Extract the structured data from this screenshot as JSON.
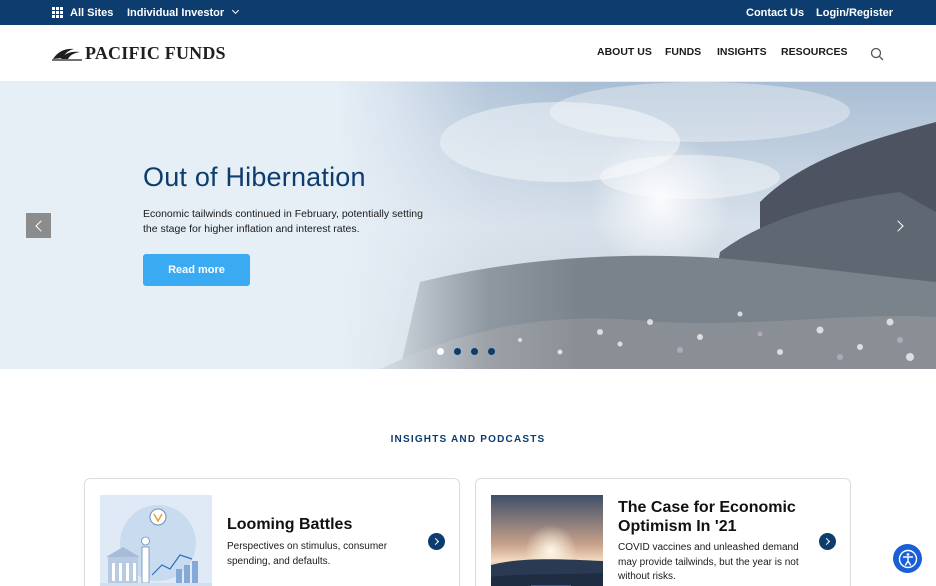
{
  "utility_bar": {
    "all_sites": "All Sites",
    "audience": "Individual Investor",
    "contact": "Contact Us",
    "login": "Login/Register"
  },
  "header": {
    "logo_text": "PACIFIC FUNDS",
    "nav": [
      "ABOUT US",
      "FUNDS",
      "INSIGHTS",
      "RESOURCES"
    ],
    "search_icon": "search-icon"
  },
  "hero": {
    "title": "Out of Hibernation",
    "text": "Economic tailwinds continued in February, potentially setting the stage for higher inflation and interest rates.",
    "button": "Read more",
    "slide_count": 4,
    "active_slide": 1
  },
  "insights": {
    "section_title": "INSIGHTS AND PODCASTS",
    "cards": [
      {
        "title": "Looming Battles",
        "text": "Perspectives on stimulus, consumer spending, and defaults."
      },
      {
        "title": "The Case for Economic Optimism In '21",
        "text": "COVID vaccines and unleashed demand may provide tailwinds, but the year is not without risks."
      }
    ]
  },
  "colors": {
    "navy": "#0d3d6e",
    "button_blue": "#3aaaf2",
    "accessibility_blue": "#1a5fd6"
  }
}
